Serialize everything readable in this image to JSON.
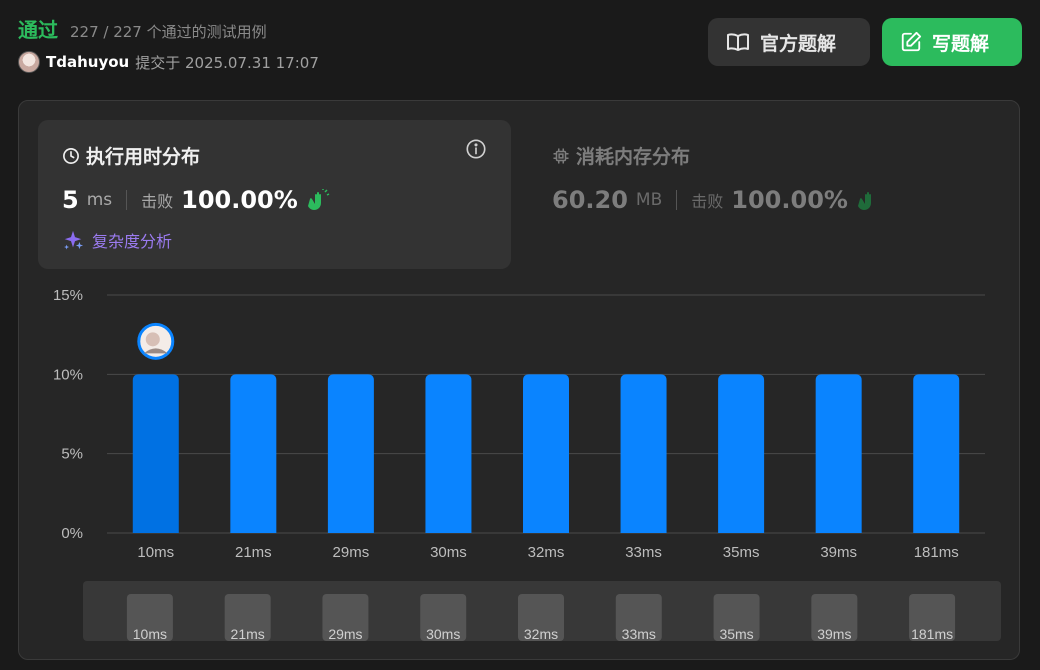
{
  "header": {
    "status": "通过",
    "count_text": "227 / 227 个通过的测试用例",
    "username": "Tdahuyou",
    "submit_text": "提交于 2025.07.31 17:07",
    "btn_solution": "官方题解",
    "btn_write": "写题解"
  },
  "runtime": {
    "title": "执行用时分布",
    "value": "5",
    "unit": "ms",
    "beat_label": "击败",
    "beat_value": "100.00%",
    "complexity": "复杂度分析"
  },
  "memory": {
    "title": "消耗内存分布",
    "value": "60.20",
    "unit": "MB",
    "beat_label": "击败",
    "beat_value": "100.00%"
  },
  "colors": {
    "accent_green": "#2cbb5d",
    "bar_blue": "#0a84ff",
    "bar_selected": "#0071e3",
    "purple": "#9b7bf0"
  },
  "icons": {
    "book": "book-icon",
    "edit": "edit-icon",
    "clock": "clock-icon",
    "info": "info-icon",
    "chip": "chip-icon",
    "clap": "clap-icon",
    "sparkle": "sparkle-icon"
  },
  "chart_data": {
    "type": "bar",
    "categories": [
      "10ms",
      "21ms",
      "29ms",
      "30ms",
      "32ms",
      "33ms",
      "35ms",
      "39ms",
      "181ms"
    ],
    "values": [
      10,
      10,
      10,
      10,
      10,
      10,
      10,
      10,
      10
    ],
    "y_tick_labels": [
      "15%",
      "10%",
      "5%",
      "0%"
    ],
    "ylim": [
      0,
      15
    ],
    "y_ticks": [
      15,
      10,
      5,
      0
    ],
    "selected_index": 0,
    "grid": true
  },
  "slider_labels": [
    "10ms",
    "21ms",
    "29ms",
    "30ms",
    "32ms",
    "33ms",
    "35ms",
    "39ms",
    "181ms"
  ]
}
